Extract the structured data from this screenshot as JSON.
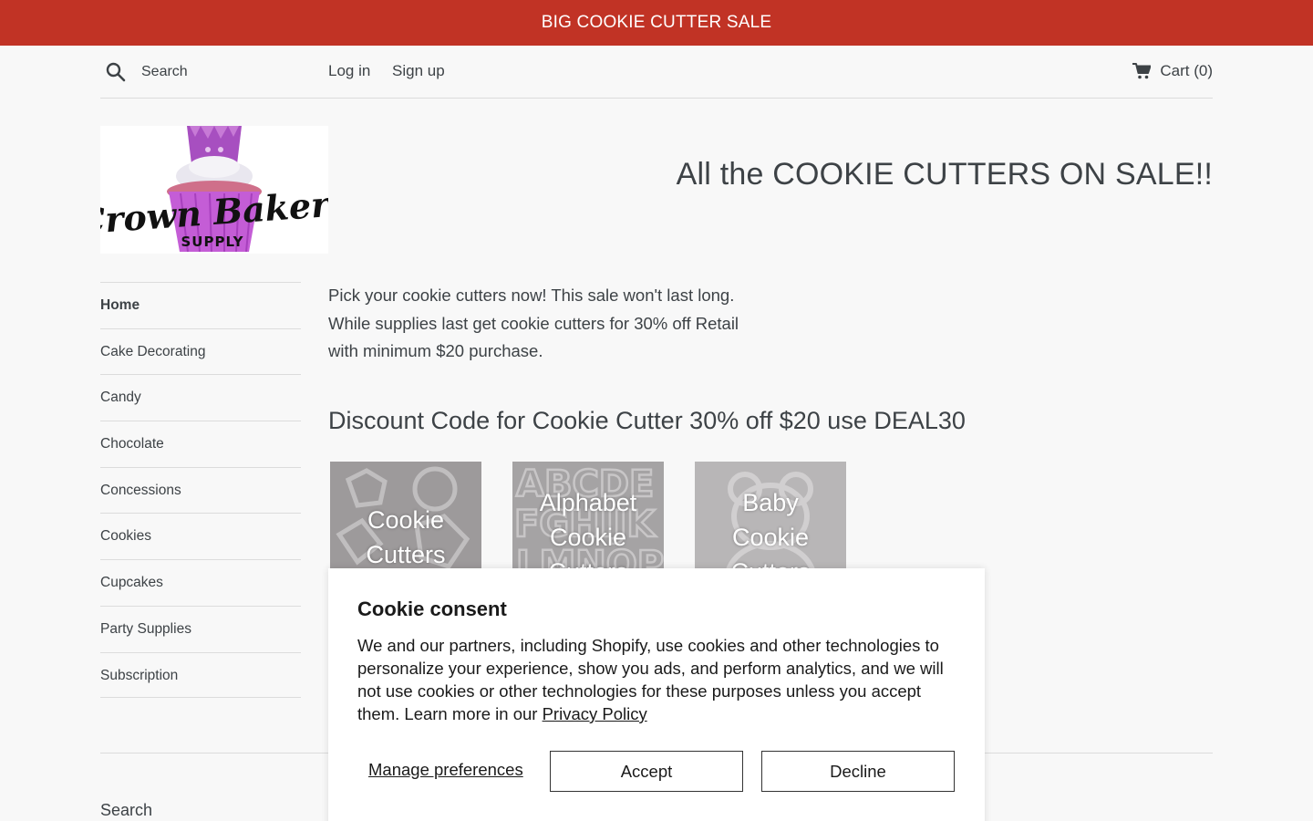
{
  "announcement": "BIG COOKIE CUTTER SALE",
  "header": {
    "search_placeholder": "Search",
    "login": "Log in",
    "signup": "Sign up",
    "cart": "Cart (0)"
  },
  "logo": {
    "alt": "Crown Bakery Supply",
    "script_text": "Crown Bakery",
    "sub_text": "SUPPLY"
  },
  "hero_title": "All the COOKIE CUTTERS ON SALE!!",
  "sidebar": {
    "items": [
      {
        "label": "Home",
        "active": true
      },
      {
        "label": "Cake Decorating"
      },
      {
        "label": "Candy"
      },
      {
        "label": "Chocolate"
      },
      {
        "label": "Concessions"
      },
      {
        "label": "Cookies"
      },
      {
        "label": "Cupcakes"
      },
      {
        "label": "Party Supplies"
      },
      {
        "label": "Subscription"
      }
    ]
  },
  "intro": {
    "line1": "Pick your cookie cutters now! This sale won't last long.",
    "line2": "While supplies last get cookie cutters for 30% off Retail",
    "line3": "with minimum $20 purchase."
  },
  "discount_heading": "Discount Code for Cookie Cutter 30% off $20 use DEAL30",
  "collections": [
    {
      "line1": "Cookie",
      "line2": "Cutters"
    },
    {
      "line1": "Alphabet",
      "line2": "Cookie",
      "line3": "Cutters",
      "bg_letters": "ABCDE FGHIJK LMNOP QRSTU"
    },
    {
      "line1": "Baby",
      "line2": "Cookie",
      "line3": "Cutters"
    }
  ],
  "footer": {
    "search_label": "Search"
  },
  "cookie_consent": {
    "title": "Cookie consent",
    "body": "We and our partners, including Shopify, use cookies and other technologies to personalize your experience, show you ads, and perform analytics, and we will not use cookies or other technologies for these purposes unless you accept them. Learn more in our ",
    "privacy_link": "Privacy Policy",
    "manage": "Manage preferences",
    "accept": "Accept",
    "decline": "Decline"
  },
  "colors": {
    "announcement_bg": "#c13325",
    "text": "#3d4246",
    "page_bg": "#f8f8f8"
  }
}
